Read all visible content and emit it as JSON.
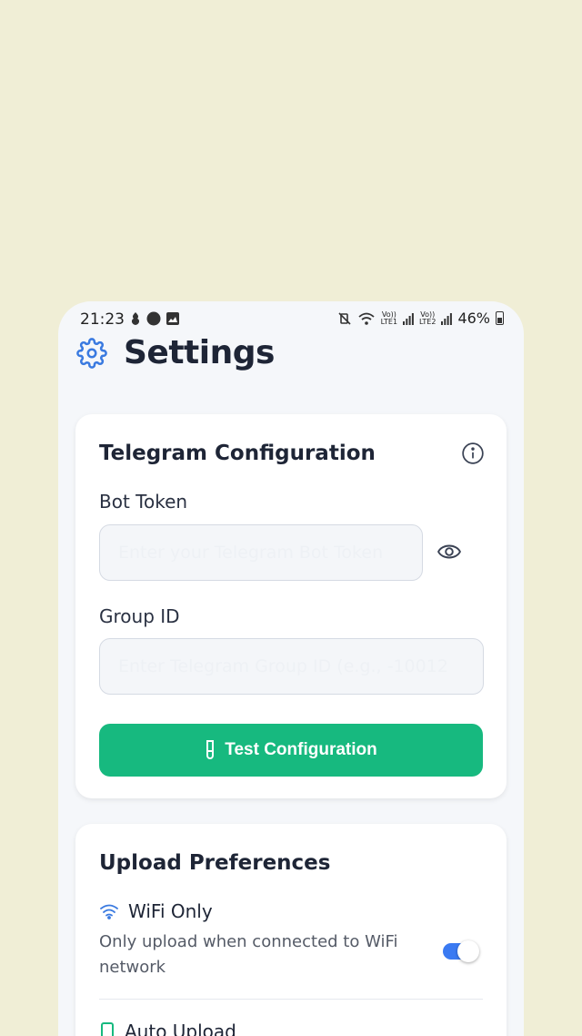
{
  "status_bar": {
    "time": "21:23",
    "net1": "Vo))\nLTE1",
    "net2": "Vo))\nLTE2",
    "battery": "46%"
  },
  "header": {
    "title": "Settings",
    "icon": "gear-icon",
    "accent": "#3a7ae0"
  },
  "telegram": {
    "title": "Telegram Configuration",
    "bot_token_label": "Bot Token",
    "bot_token_placeholder": "Enter your Telegram Bot Token",
    "group_id_label": "Group ID",
    "group_id_placeholder": "Enter Telegram Group ID (e.g., -10012",
    "test_button": "Test Configuration",
    "button_color": "#17b97f"
  },
  "upload": {
    "title": "Upload Preferences",
    "wifi_only": {
      "label": "WiFi Only",
      "description": "Only upload when connected to WiFi network",
      "enabled": true
    },
    "auto_upload": {
      "label": "Auto Upload"
    }
  }
}
